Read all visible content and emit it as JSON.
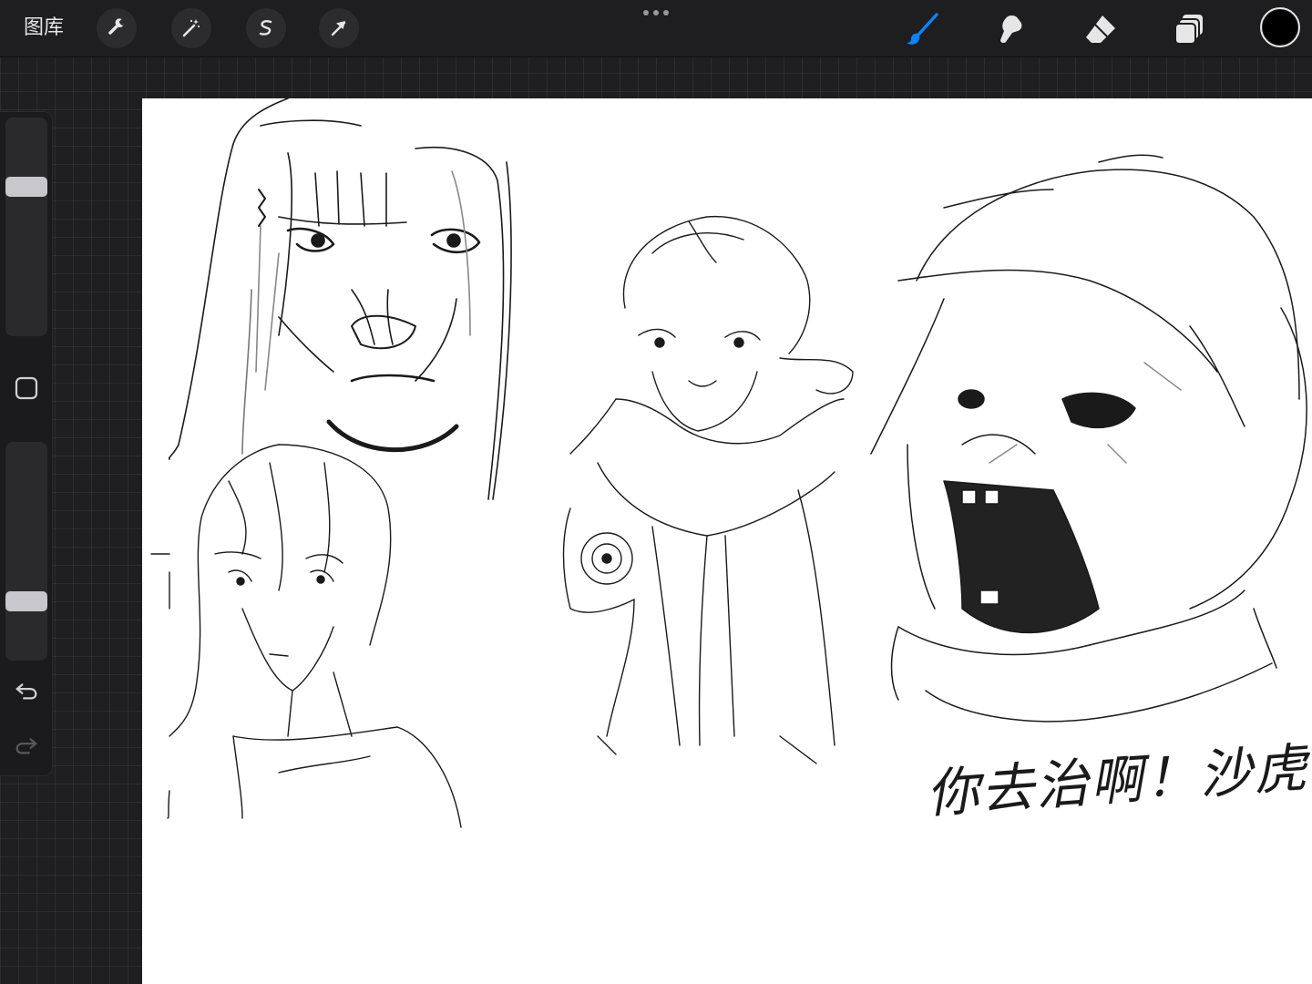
{
  "toolbar": {
    "gallery_label": "图库",
    "actions_icon": "wrench-icon",
    "adjustments_icon": "magic-wand-icon",
    "selection_icon": "selection-s-icon",
    "transform_icon": "arrow-cursor-icon",
    "more_icon": "ellipsis-icon",
    "brush_icon": "brush-icon",
    "smudge_icon": "smudge-finger-icon",
    "eraser_icon": "eraser-icon",
    "layers_icon": "layers-icon",
    "active_color": "#000000",
    "accent_color": "#0a84ff"
  },
  "sidebar": {
    "brush_size_level": 0.7,
    "opacity_level": 0.25,
    "modify_icon": "square-icon",
    "undo_icon": "undo-icon",
    "redo_icon": "redo-icon"
  },
  "canvas": {
    "handwritten_caption": "你去治啊！沙虎！"
  }
}
